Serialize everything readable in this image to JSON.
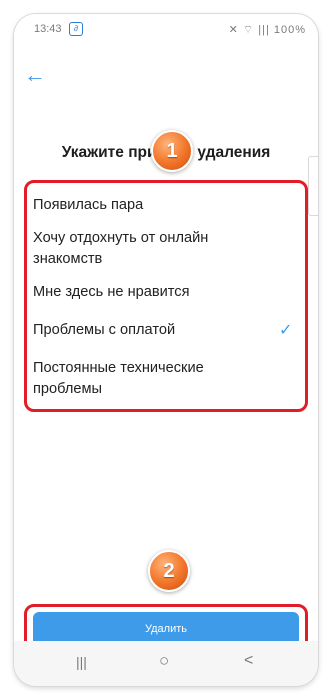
{
  "status_bar": {
    "time": "13:43",
    "notification_icon": "app-notification-icon",
    "right_text": "✕ ⌔ ||| 100%"
  },
  "header": {
    "back_icon": "back-arrow-icon"
  },
  "heading": "Укажите причину удаления",
  "options": [
    {
      "label": "Появилась пара",
      "selected": false
    },
    {
      "label": "Хочу отдохнуть от онлайн знакомств",
      "selected": false
    },
    {
      "label": "Мне здесь не нравится",
      "selected": false
    },
    {
      "label": "Проблемы с оплатой",
      "selected": true
    },
    {
      "label": "Постоянные технические проблемы",
      "selected": false
    }
  ],
  "callouts": {
    "one": "1",
    "two": "2"
  },
  "delete_button": "Удалить",
  "nav_bar": {
    "recent": "|||",
    "home": "○",
    "back": "<"
  },
  "colors": {
    "accent": "#3d9be9",
    "highlight": "#e11d27",
    "badge": "#f17427"
  }
}
